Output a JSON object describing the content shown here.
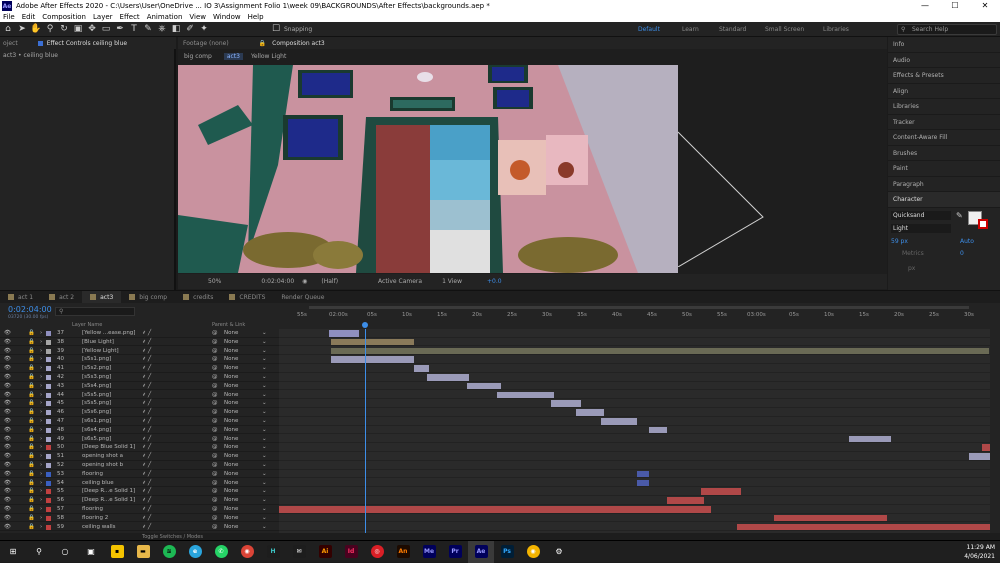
{
  "window": {
    "title": "Adobe After Effects 2020 - C:\\Users\\User\\OneDrive ... IO 3\\Assignment Folio 1\\week 09\\BACKGROUNDS\\After Effects\\backgrounds.aep *",
    "minimize": "—",
    "maximize": "☐",
    "close": "✕"
  },
  "menu": [
    "File",
    "Edit",
    "Composition",
    "Layer",
    "Effect",
    "Animation",
    "View",
    "Window",
    "Help"
  ],
  "toolbar": {
    "snapping": "Snapping",
    "workspaces": [
      "Default",
      "Learn",
      "Standard",
      "Small Screen",
      "Libraries"
    ],
    "search_placeholder": "Search Help"
  },
  "left_panel": {
    "tab_project": "oject",
    "tab_effect": "Effect Controls ceiling blue",
    "breadcrumb": "act3 • ceiling blue"
  },
  "comp_panel": {
    "tab_footage": "Footage (none)",
    "tab_comp": "Composition act3",
    "crumbs": [
      "big comp",
      "act3",
      "Yellow Light"
    ],
    "zoom": "50%",
    "timecode": "0:02:04:00",
    "resolution": "(Half)",
    "camera": "Active Camera",
    "views": "1 View",
    "exposure": "+0.0"
  },
  "right_panel": {
    "items": [
      "Info",
      "Audio",
      "Effects & Presets",
      "Align",
      "Libraries",
      "Tracker",
      "Content-Aware Fill",
      "Brushes",
      "Paint",
      "Paragraph",
      "Character"
    ],
    "font": "Quicksand",
    "style": "Light",
    "size": "59 px",
    "leading": "Auto",
    "metrics": "Metrics",
    "tracking": "0",
    "units": "px"
  },
  "timeline": {
    "tabs": [
      {
        "label": "act 1",
        "color": "#8a7a52"
      },
      {
        "label": "act 2",
        "color": "#8a7a52"
      },
      {
        "label": "act3",
        "color": "#8a7a52",
        "active": true
      },
      {
        "label": "big comp",
        "color": "#8a7a52"
      },
      {
        "label": "credits",
        "color": "#8a7a52"
      },
      {
        "label": "CREDITS",
        "color": "#8a7a52"
      },
      {
        "label": "Render Queue",
        "color": ""
      }
    ],
    "current_time": "0:02:04:00",
    "frame_info": "03720 (30.00 fps)",
    "columns": {
      "layer_name": "Layer Name",
      "parent": "Parent & Link"
    },
    "ruler": [
      "55s",
      "02:00s",
      "05s",
      "10s",
      "15s",
      "20s",
      "25s",
      "30s",
      "35s",
      "40s",
      "45s",
      "50s",
      "55s",
      "03:00s",
      "05s",
      "10s",
      "15s",
      "20s",
      "25s",
      "30s"
    ],
    "toggle_label": "Toggle Switches / Modes",
    "layers": [
      {
        "num": "37",
        "name": "[Yellow ...ease.png]",
        "color": "#8f8fbf",
        "parent": "None"
      },
      {
        "num": "38",
        "name": "[Blue Light]",
        "color": "#a5a5a5",
        "parent": "None"
      },
      {
        "num": "39",
        "name": "[Yellow Light]",
        "color": "#a5a5a5",
        "parent": "None"
      },
      {
        "num": "40",
        "name": "[s5s1.png]",
        "color": "#a5a5c8",
        "parent": "None"
      },
      {
        "num": "41",
        "name": "[s5s2.png]",
        "color": "#a5a5c8",
        "parent": "None"
      },
      {
        "num": "42",
        "name": "[s5s3.png]",
        "color": "#a5a5c8",
        "parent": "None"
      },
      {
        "num": "43",
        "name": "[s5s4.png]",
        "color": "#a5a5c8",
        "parent": "None"
      },
      {
        "num": "44",
        "name": "[s5s5.png]",
        "color": "#a5a5c8",
        "parent": "None"
      },
      {
        "num": "45",
        "name": "[s5s5.png]",
        "color": "#a5a5c8",
        "parent": "None"
      },
      {
        "num": "46",
        "name": "[s5s6.png]",
        "color": "#a5a5c8",
        "parent": "None"
      },
      {
        "num": "47",
        "name": "[s6s1.png]",
        "color": "#a5a5c8",
        "parent": "None"
      },
      {
        "num": "48",
        "name": "[s6s4.png]",
        "color": "#a5a5c8",
        "parent": "None"
      },
      {
        "num": "49",
        "name": "[s6s5.png]",
        "color": "#a5a5c8",
        "parent": "None"
      },
      {
        "num": "50",
        "name": "[Deep Blue Solid 1]",
        "color": "#c04040",
        "parent": "None"
      },
      {
        "num": "51",
        "name": "opening shot a",
        "color": "#a5a5c8",
        "parent": "None"
      },
      {
        "num": "52",
        "name": "opening shot b",
        "color": "#a5a5c8",
        "parent": "None"
      },
      {
        "num": "53",
        "name": "flooring",
        "color": "#3a5fc0",
        "parent": "None"
      },
      {
        "num": "54",
        "name": "ceiling blue",
        "color": "#3a5fc0",
        "parent": "None"
      },
      {
        "num": "55",
        "name": "[Deep R...e Solid 1]",
        "color": "#c04040",
        "parent": "None"
      },
      {
        "num": "56",
        "name": "[Deep R...e Solid 1]",
        "color": "#c04040",
        "parent": "None"
      },
      {
        "num": "57",
        "name": "flooring",
        "color": "#c04040",
        "parent": "None"
      },
      {
        "num": "58",
        "name": "flooring 2",
        "color": "#c04040",
        "parent": "None"
      },
      {
        "num": "59",
        "name": "ceiling walls",
        "color": "#c04040",
        "parent": "None"
      }
    ]
  },
  "taskbar": {
    "time": "11:29 AM",
    "date": "4/06/2021"
  }
}
